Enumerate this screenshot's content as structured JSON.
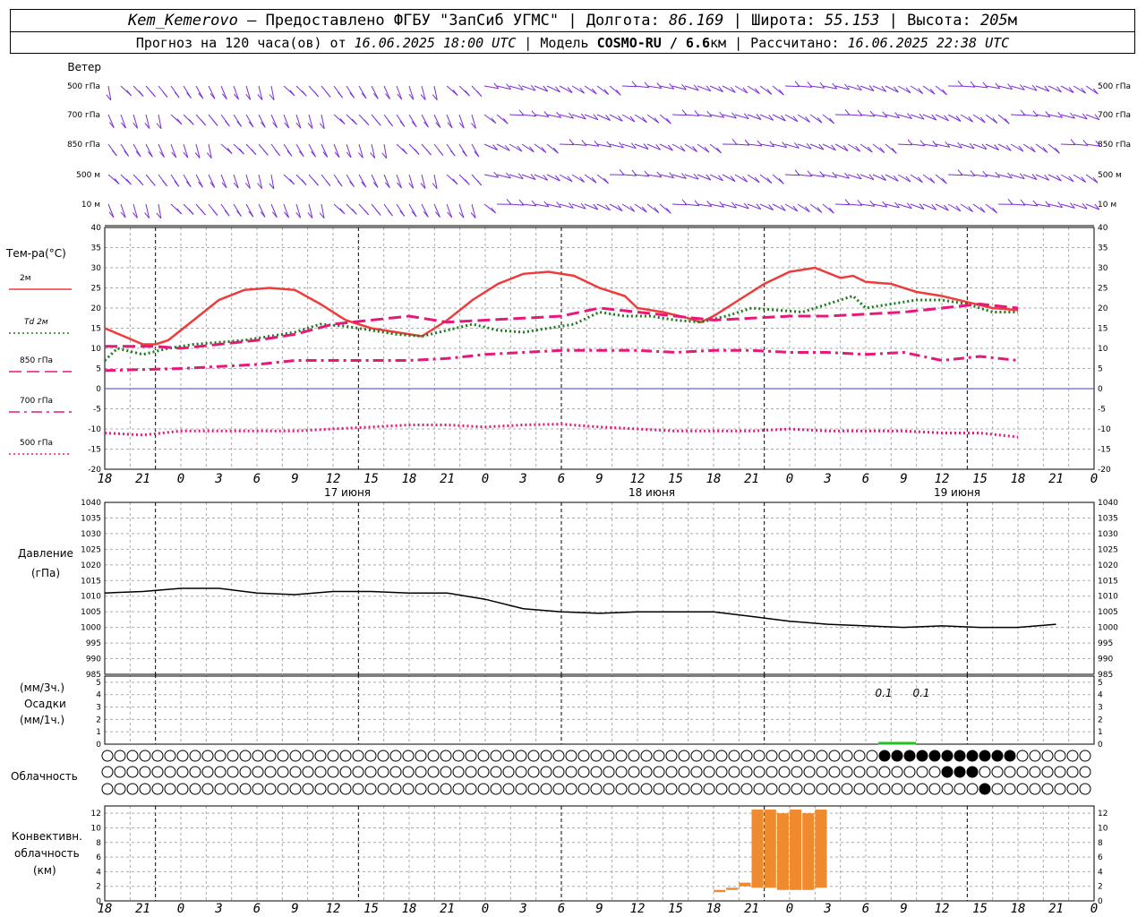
{
  "header": {
    "station": "Kem_Kemerovo",
    "provided": " — Предоставлено ФГБУ \"ЗапСиб УГМС\" | Долгота: ",
    "lon": "86.169",
    "lat_label": " | Широта: ",
    "lat": "55.153",
    "alt_label": " | Высота: ",
    "alt": "205",
    "alt_unit": "м",
    "forecast_label": "Прогноз на 120 часа(ов) от ",
    "forecast_from": "16.06.2025 18:00 UTC",
    "model_label": " | Модель ",
    "model": "COSMO-RU / 6.6",
    "model_unit": "км",
    "calc_label": " | Рассчитано: ",
    "calc_time": "16.06.2025 22:38 UTC"
  },
  "wind_panel": {
    "title": "Ветер",
    "levels": [
      "500 гПа",
      "700 гПа",
      "850 гПа",
      "500 м",
      "10  м"
    ],
    "color": "#7b2fd6"
  },
  "temp_panel": {
    "title": "Тем-ра(°C)",
    "legend": [
      {
        "label": "2м",
        "color": "#ee3b3b",
        "style": "solid"
      },
      {
        "label": "Td  2м",
        "color": "#1a7a1a",
        "style": "dot"
      },
      {
        "label": "850 гПа",
        "color": "#e5197a",
        "style": "dash"
      },
      {
        "label": "700 гПа",
        "color": "#e5197a",
        "style": "dashdot"
      },
      {
        "label": "500 гПа",
        "color": "#e5197a",
        "style": "dot"
      }
    ]
  },
  "pressure_panel": {
    "title_1": "Давление",
    "title_2": "(гПа)"
  },
  "precip_panel": {
    "title_1": "(мм/3ч.)",
    "title_2": "Осадки",
    "title_3": "(мм/1ч.)",
    "annotations": [
      "0.1",
      "0.1"
    ]
  },
  "cloud_panel": {
    "title": "Облачность"
  },
  "conv_panel": {
    "title_1": "Конвективн.",
    "title_2": "облачность",
    "title_3": "(км)",
    "color": "#f08a2e"
  },
  "time_axis": {
    "hour_labels": [
      "18",
      "21",
      "0",
      "3",
      "6",
      "9",
      "12",
      "15",
      "18",
      "21",
      "0",
      "3",
      "6",
      "9",
      "12",
      "15",
      "18",
      "21",
      "0",
      "3",
      "6",
      "9",
      "12",
      "15",
      "18",
      "21",
      "0"
    ],
    "day_labels": [
      "17 июня",
      "18 июня",
      "19 июня"
    ]
  },
  "chart_data": [
    {
      "type": "line",
      "title": "Тем-ра(°C)",
      "x_hours": [
        0,
        120
      ],
      "ylim": [
        -20,
        40
      ],
      "yticks": [
        40,
        35,
        30,
        25,
        20,
        15,
        10,
        5,
        0,
        -5,
        -10,
        -15,
        -20
      ],
      "series": [
        {
          "name": "2м",
          "color": "#ee3b3b",
          "points": [
            [
              0,
              15
            ],
            [
              3,
              13
            ],
            [
              6,
              11
            ],
            [
              8,
              11
            ],
            [
              10,
              12
            ],
            [
              14,
              17
            ],
            [
              18,
              22
            ],
            [
              22,
              24.5
            ],
            [
              26,
              25
            ],
            [
              30,
              24.5
            ],
            [
              34,
              21
            ],
            [
              38,
              17
            ],
            [
              42,
              15
            ],
            [
              46,
              14
            ],
            [
              50,
              13
            ],
            [
              54,
              17
            ],
            [
              58,
              22
            ],
            [
              62,
              26
            ],
            [
              66,
              28.5
            ],
            [
              70,
              29
            ],
            [
              74,
              28
            ],
            [
              78,
              25
            ],
            [
              82,
              23
            ],
            [
              84,
              20
            ],
            [
              88,
              19
            ],
            [
              92,
              17.5
            ],
            [
              94,
              16.5
            ],
            [
              96,
              18
            ],
            [
              100,
              22
            ],
            [
              104,
              26
            ],
            [
              108,
              29
            ],
            [
              112,
              30
            ],
            [
              116,
              27.5
            ],
            [
              118,
              28
            ],
            [
              120,
              26.5
            ],
            [
              124,
              26
            ],
            [
              128,
              24
            ],
            [
              132,
              23
            ],
            [
              136,
              21.5
            ],
            [
              140,
              20
            ],
            [
              144,
              19.5
            ]
          ]
        },
        {
          "name": "Td 2м",
          "color": "#1a7a1a",
          "points": [
            [
              0,
              7
            ],
            [
              2,
              10
            ],
            [
              6,
              8.5
            ],
            [
              10,
              10
            ],
            [
              14,
              11
            ],
            [
              18,
              11.5
            ],
            [
              22,
              12
            ],
            [
              26,
              13
            ],
            [
              30,
              14
            ],
            [
              34,
              16
            ],
            [
              38,
              15.5
            ],
            [
              42,
              14.5
            ],
            [
              46,
              13.5
            ],
            [
              50,
              13
            ],
            [
              54,
              14.5
            ],
            [
              58,
              16
            ],
            [
              62,
              14.5
            ],
            [
              66,
              14
            ],
            [
              70,
              15
            ],
            [
              74,
              16
            ],
            [
              78,
              19
            ],
            [
              82,
              18
            ],
            [
              86,
              18
            ],
            [
              90,
              17
            ],
            [
              94,
              16.5
            ],
            [
              98,
              18
            ],
            [
              102,
              20
            ],
            [
              106,
              19.5
            ],
            [
              110,
              19
            ],
            [
              114,
              21
            ],
            [
              118,
              23
            ],
            [
              120,
              20
            ],
            [
              124,
              21
            ],
            [
              128,
              22
            ],
            [
              132,
              22
            ],
            [
              136,
              21
            ],
            [
              140,
              19
            ],
            [
              144,
              19
            ]
          ]
        },
        {
          "name": "850 гПа",
          "color": "#e5197a",
          "points": [
            [
              0,
              10.5
            ],
            [
              8,
              10.5
            ],
            [
              12,
              10
            ],
            [
              18,
              11
            ],
            [
              24,
              12
            ],
            [
              30,
              13.5
            ],
            [
              36,
              16
            ],
            [
              42,
              17
            ],
            [
              48,
              18
            ],
            [
              54,
              16.5
            ],
            [
              60,
              17
            ],
            [
              66,
              17.5
            ],
            [
              72,
              18
            ],
            [
              78,
              20
            ],
            [
              84,
              19
            ],
            [
              90,
              18
            ],
            [
              96,
              17
            ],
            [
              102,
              17.5
            ],
            [
              108,
              18
            ],
            [
              114,
              18
            ],
            [
              120,
              18.5
            ],
            [
              126,
              19
            ],
            [
              132,
              20
            ],
            [
              138,
              21
            ],
            [
              144,
              20
            ]
          ]
        },
        {
          "name": "700 гПа",
          "color": "#e5197a",
          "points": [
            [
              0,
              4.5
            ],
            [
              12,
              5
            ],
            [
              24,
              6
            ],
            [
              30,
              7
            ],
            [
              36,
              7
            ],
            [
              48,
              7
            ],
            [
              54,
              7.5
            ],
            [
              60,
              8.5
            ],
            [
              66,
              9
            ],
            [
              72,
              9.5
            ],
            [
              78,
              9.5
            ],
            [
              84,
              9.5
            ],
            [
              90,
              9
            ],
            [
              96,
              9.5
            ],
            [
              102,
              9.5
            ],
            [
              108,
              9
            ],
            [
              114,
              9
            ],
            [
              120,
              8.5
            ],
            [
              126,
              9
            ],
            [
              132,
              7
            ],
            [
              138,
              8
            ],
            [
              144,
              7
            ]
          ]
        },
        {
          "name": "500 гПа",
          "color": "#e5197a",
          "points": [
            [
              0,
              -11
            ],
            [
              6,
              -11.5
            ],
            [
              12,
              -10.5
            ],
            [
              18,
              -10.5
            ],
            [
              24,
              -10.5
            ],
            [
              30,
              -10.5
            ],
            [
              36,
              -10
            ],
            [
              42,
              -9.5
            ],
            [
              48,
              -9
            ],
            [
              54,
              -9
            ],
            [
              60,
              -9.5
            ],
            [
              66,
              -9
            ],
            [
              72,
              -8.8
            ],
            [
              78,
              -9.5
            ],
            [
              84,
              -10
            ],
            [
              90,
              -10.5
            ],
            [
              96,
              -10.5
            ],
            [
              102,
              -10.5
            ],
            [
              108,
              -10
            ],
            [
              114,
              -10.5
            ],
            [
              120,
              -10.5
            ],
            [
              126,
              -10.5
            ],
            [
              132,
              -11
            ],
            [
              138,
              -11
            ],
            [
              144,
              -12
            ]
          ]
        }
      ]
    },
    {
      "type": "line",
      "title": "Давление",
      "ylim": [
        985,
        1040
      ],
      "yticks": [
        1040,
        1035,
        1030,
        1025,
        1020,
        1015,
        1010,
        1005,
        1000,
        995,
        990,
        985
      ],
      "series": [
        {
          "name": "Давление",
          "color": "#000000",
          "points": [
            [
              0,
              1011
            ],
            [
              6,
              1011.5
            ],
            [
              12,
              1012.5
            ],
            [
              18,
              1012.5
            ],
            [
              24,
              1011
            ],
            [
              30,
              1010.5
            ],
            [
              36,
              1011.5
            ],
            [
              42,
              1011.5
            ],
            [
              48,
              1011
            ],
            [
              54,
              1011
            ],
            [
              60,
              1009
            ],
            [
              66,
              1006
            ],
            [
              72,
              1005
            ],
            [
              78,
              1004.5
            ],
            [
              84,
              1005
            ],
            [
              90,
              1005
            ],
            [
              96,
              1005
            ],
            [
              102,
              1003.5
            ],
            [
              108,
              1002
            ],
            [
              114,
              1001
            ],
            [
              120,
              1000.5
            ],
            [
              126,
              1000
            ],
            [
              132,
              1000.5
            ],
            [
              138,
              1000
            ],
            [
              144,
              1000
            ],
            [
              150,
              1001
            ]
          ]
        }
      ]
    },
    {
      "type": "bar",
      "title": "Конвективн. облачность",
      "ylim": [
        0,
        13
      ],
      "yticks": [
        12,
        10,
        8,
        6,
        4,
        2,
        0
      ],
      "bars": [
        {
          "start": 96,
          "end": 98,
          "base": 1.2,
          "top": 1.5
        },
        {
          "start": 98,
          "end": 100,
          "base": 1.5,
          "top": 1.8
        },
        {
          "start": 100,
          "end": 102,
          "base": 2,
          "top": 2.5
        },
        {
          "start": 102,
          "end": 104,
          "base": 1.8,
          "top": 12.5
        },
        {
          "start": 104,
          "end": 106,
          "base": 1.8,
          "top": 12.5
        },
        {
          "start": 106,
          "end": 108,
          "base": 1.5,
          "top": 12
        },
        {
          "start": 108,
          "end": 110,
          "base": 1.5,
          "top": 12.5
        },
        {
          "start": 110,
          "end": 112,
          "base": 1.5,
          "top": 12
        },
        {
          "start": 112,
          "end": 114,
          "base": 1.8,
          "top": 12.5
        }
      ]
    }
  ]
}
